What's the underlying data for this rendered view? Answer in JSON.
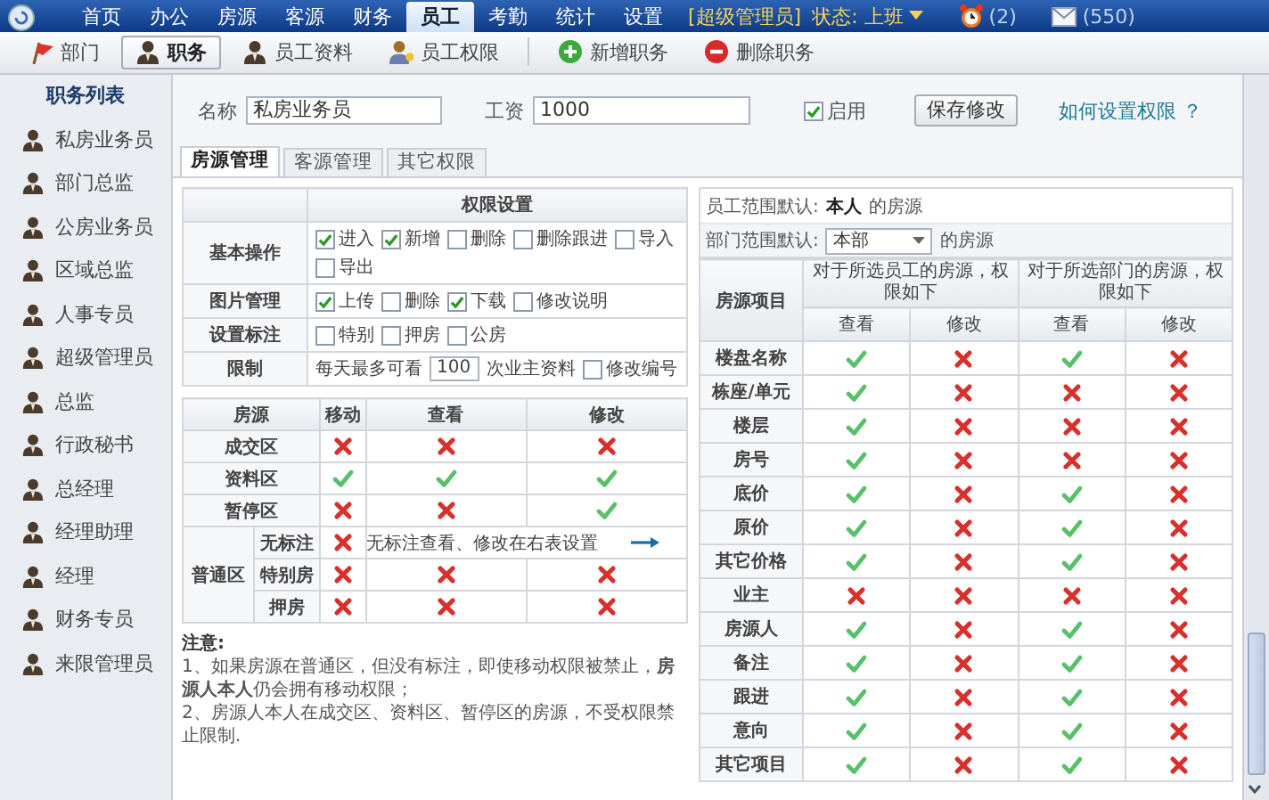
{
  "nav": {
    "tabs": [
      {
        "label": "首页",
        "selected": false
      },
      {
        "label": "办公",
        "selected": false
      },
      {
        "label": "房源",
        "selected": false
      },
      {
        "label": "客源",
        "selected": false
      },
      {
        "label": "财务",
        "selected": false
      },
      {
        "label": "员工",
        "selected": true
      },
      {
        "label": "考勤",
        "selected": false
      },
      {
        "label": "统计",
        "selected": false
      },
      {
        "label": "设置",
        "selected": false
      }
    ],
    "role": "[超级管理员]",
    "status": "状态: 上班",
    "alarm_count": "(2)",
    "mail_count": "(550)"
  },
  "toolbar": [
    {
      "kind": "flag",
      "label": "部门",
      "selected": false
    },
    {
      "kind": "person",
      "label": "职务",
      "selected": true
    },
    {
      "kind": "person",
      "label": "员工资料",
      "selected": false
    },
    {
      "kind": "person-key",
      "label": "员工权限",
      "selected": false
    },
    {
      "kind": "add",
      "label": "新增职务",
      "selected": false
    },
    {
      "kind": "delete",
      "label": "删除职务",
      "selected": false
    }
  ],
  "sidebar": {
    "title": "职务列表",
    "items": [
      "私房业务员",
      "部门总监",
      "公房业务员",
      "区域总监",
      "人事专员",
      "超级管理员",
      "总监",
      "行政秘书",
      "总经理",
      "经理助理",
      "经理",
      "财务专员",
      "来限管理员"
    ]
  },
  "form": {
    "name_label": "名称",
    "name_value": "私房业务员",
    "salary_label": "工资",
    "salary_value": "1000",
    "enabled": {
      "label": "启用",
      "checked": true
    },
    "save_button": "保存修改",
    "help_link": "如何设置权限 ？"
  },
  "tabs": [
    {
      "label": "房源管理",
      "selected": true
    },
    {
      "label": "客源管理",
      "selected": false
    },
    {
      "label": "其它权限",
      "selected": false
    }
  ],
  "permissions": {
    "header": "权限设置",
    "rows": [
      {
        "kind": "options",
        "label": "基本操作",
        "options": [
          {
            "label": "进入",
            "checked": true
          },
          {
            "label": "新增",
            "checked": true
          },
          {
            "label": "删除",
            "checked": false
          },
          {
            "label": "删除跟进",
            "checked": false
          },
          {
            "label": "导入",
            "checked": false
          },
          {
            "label": "导出",
            "checked": false
          }
        ]
      },
      {
        "kind": "options",
        "label": "图片管理",
        "options": [
          {
            "label": "上传",
            "checked": true
          },
          {
            "label": "删除",
            "checked": false
          },
          {
            "label": "下载",
            "checked": true
          },
          {
            "label": "修改说明",
            "checked": false
          }
        ]
      },
      {
        "kind": "options",
        "label": "设置标注",
        "options": [
          {
            "label": "特别",
            "checked": false
          },
          {
            "label": "押房",
            "checked": false
          },
          {
            "label": "公房",
            "checked": false
          }
        ]
      },
      {
        "kind": "limit",
        "label": "限制",
        "prefix": "每天最多可看",
        "value": "100",
        "suffix": "次业主资料",
        "options": [
          {
            "label": "修改编号",
            "checked": false
          }
        ]
      }
    ]
  },
  "area_table": {
    "columns": [
      "房源",
      "移动",
      "查看",
      "修改"
    ],
    "rows": [
      {
        "label": "成交区",
        "permits": [
          false,
          false,
          false
        ]
      },
      {
        "label": "资料区",
        "permits": [
          true,
          true,
          true
        ]
      },
      {
        "label": "暂停区",
        "permits": [
          false,
          false,
          true
        ]
      }
    ],
    "group": {
      "label": "普通区",
      "rows": [
        {
          "label": "无标注",
          "permits": [
            false
          ],
          "note": "无标注查看、修改在右表设置"
        },
        {
          "label": "特别房",
          "permits": [
            false,
            false,
            false
          ]
        },
        {
          "label": "押房",
          "permits": [
            false,
            false,
            false
          ]
        }
      ]
    }
  },
  "notes": {
    "title": "注意:",
    "items": [
      "1、如果房源在普通区，但没有标注，即使移动权限被禁止，**房源人本人**仍会拥有移动权限；",
      "2、房源人本人在成交区、资料区、暂停区的房源，不受权限禁止限制."
    ]
  },
  "scope": {
    "staff_label": "员工范围默认:",
    "staff_value": "本人",
    "staff_suffix": "的房源",
    "dept_label": "部门范围默认:",
    "dept_value": "本部",
    "dept_suffix": "的房源"
  },
  "field_table": {
    "item_header": "房源项目",
    "groups": [
      "对于所选员工的房源，权限如下",
      "对于所选部门的房源，权限如下"
    ],
    "sub_columns": [
      "查看",
      "修改",
      "查看",
      "修改"
    ],
    "rows": [
      {
        "label": "楼盘名称",
        "permits": [
          true,
          false,
          true,
          false
        ]
      },
      {
        "label": "栋座/单元",
        "permits": [
          true,
          false,
          false,
          false
        ]
      },
      {
        "label": "楼层",
        "permits": [
          true,
          false,
          false,
          false
        ]
      },
      {
        "label": "房号",
        "permits": [
          true,
          false,
          false,
          false
        ]
      },
      {
        "label": "底价",
        "permits": [
          true,
          false,
          true,
          false
        ]
      },
      {
        "label": "原价",
        "permits": [
          true,
          false,
          true,
          false
        ]
      },
      {
        "label": "其它价格",
        "permits": [
          true,
          false,
          true,
          false
        ]
      },
      {
        "label": "业主",
        "permits": [
          false,
          false,
          false,
          false
        ]
      },
      {
        "label": "房源人",
        "permits": [
          true,
          false,
          true,
          false
        ]
      },
      {
        "label": "备注",
        "permits": [
          true,
          false,
          true,
          false
        ]
      },
      {
        "label": "跟进",
        "permits": [
          true,
          false,
          true,
          false
        ]
      },
      {
        "label": "意向",
        "permits": [
          true,
          false,
          true,
          false
        ]
      },
      {
        "label": "其它项目",
        "permits": [
          true,
          false,
          true,
          false
        ]
      }
    ]
  }
}
